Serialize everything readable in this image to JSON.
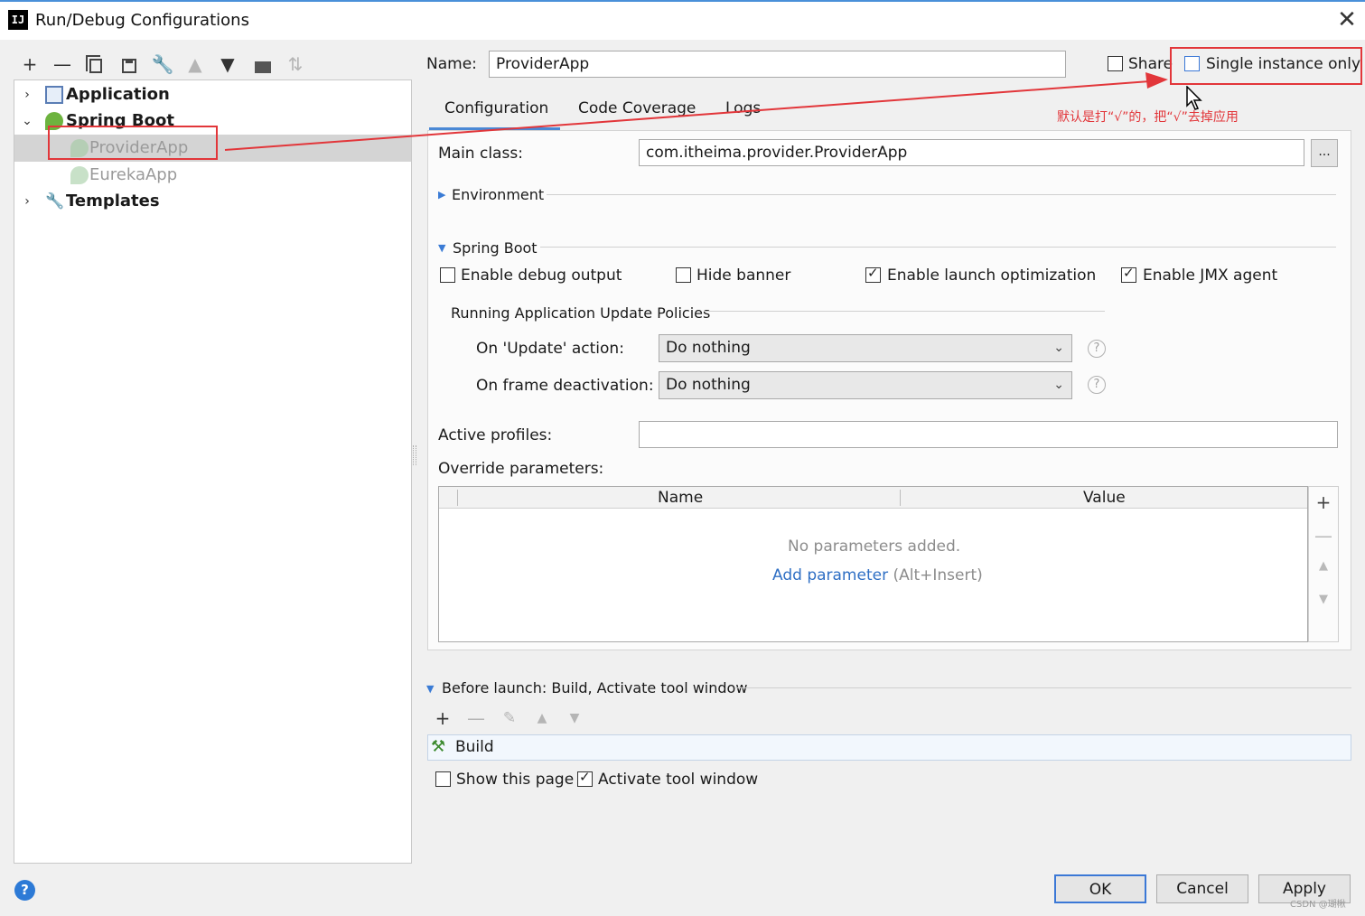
{
  "window": {
    "title": "Run/Debug Configurations",
    "app_icon_text": "IJ"
  },
  "tree": {
    "items": [
      {
        "label": "Application"
      },
      {
        "label": "Spring Boot"
      },
      {
        "label": "ProviderApp"
      },
      {
        "label": "EurekaApp"
      },
      {
        "label": "Templates"
      }
    ]
  },
  "header": {
    "name_label": "Name:",
    "name_value": "ProviderApp",
    "share_label": "Share",
    "single_instance_label": "Single instance only",
    "single_instance_checked": false,
    "share_checked": false
  },
  "tabs": [
    {
      "label": "Configuration",
      "active": true
    },
    {
      "label": "Code Coverage"
    },
    {
      "label": "Logs"
    }
  ],
  "annotation": {
    "text": "默认是打“√”的，把“√”去掉应用",
    "color": "#e2363a"
  },
  "config": {
    "main_class_label": "Main class:",
    "main_class_value": "com.itheima.provider.ProviderApp",
    "browse_label": "...",
    "environment_label": "Environment",
    "spring_boot_label": "Spring Boot",
    "options": [
      {
        "label": "Enable debug output",
        "checked": false
      },
      {
        "label": "Hide banner",
        "checked": false
      },
      {
        "label": "Enable launch optimization",
        "checked": true
      },
      {
        "label": "Enable JMX agent",
        "checked": true
      }
    ],
    "policies_label": "Running Application Update Policies",
    "update_action_label": "On 'Update' action:",
    "update_action_value": "Do nothing",
    "frame_deactivation_label": "On frame deactivation:",
    "frame_deactivation_value": "Do nothing",
    "help_glyph": "?",
    "active_profiles_label": "Active profiles:",
    "active_profiles_value": "",
    "override_label": "Override parameters:",
    "table_headers": [
      "Name",
      "Value"
    ],
    "empty_text": "No parameters added.",
    "add_param_link": "Add parameter",
    "add_param_hint": "(Alt+Insert)"
  },
  "before_launch": {
    "label": "Before launch: Build, Activate tool window",
    "task": "Build",
    "show_page_label": "Show this page",
    "show_page_checked": false,
    "activate_label": "Activate tool window",
    "activate_checked": true
  },
  "buttons": {
    "ok": "OK",
    "cancel": "Cancel",
    "apply": "Apply"
  },
  "footer": {
    "help_glyph": "?",
    "watermark": "CSDN @瑚楸"
  }
}
